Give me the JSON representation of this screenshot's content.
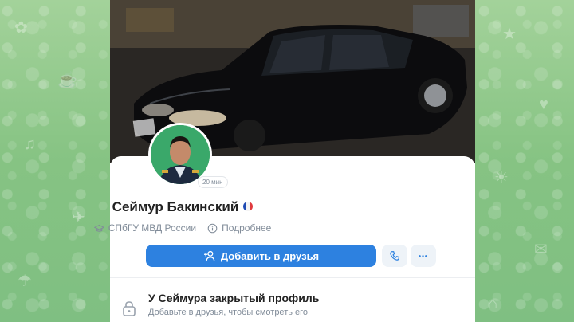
{
  "profile": {
    "name": "Сеймур Бакинский",
    "flag": "france-flag",
    "last_seen": "20 мин",
    "university": "СПбГУ МВД России",
    "more_label": "Подробнее"
  },
  "actions": {
    "add_friend_label": "Добавить в друзья",
    "call_icon": "phone-icon",
    "more_icon": "more-dots-icon",
    "more_symbol": "•••"
  },
  "privacy": {
    "title": "У Сеймура закрытый профиль",
    "subtitle": "Добавьте в друзья, чтобы смотреть его"
  },
  "colors": {
    "accent": "#2d81e0",
    "secondary_text": "#818c99",
    "background_pattern": "#8fc98a"
  }
}
